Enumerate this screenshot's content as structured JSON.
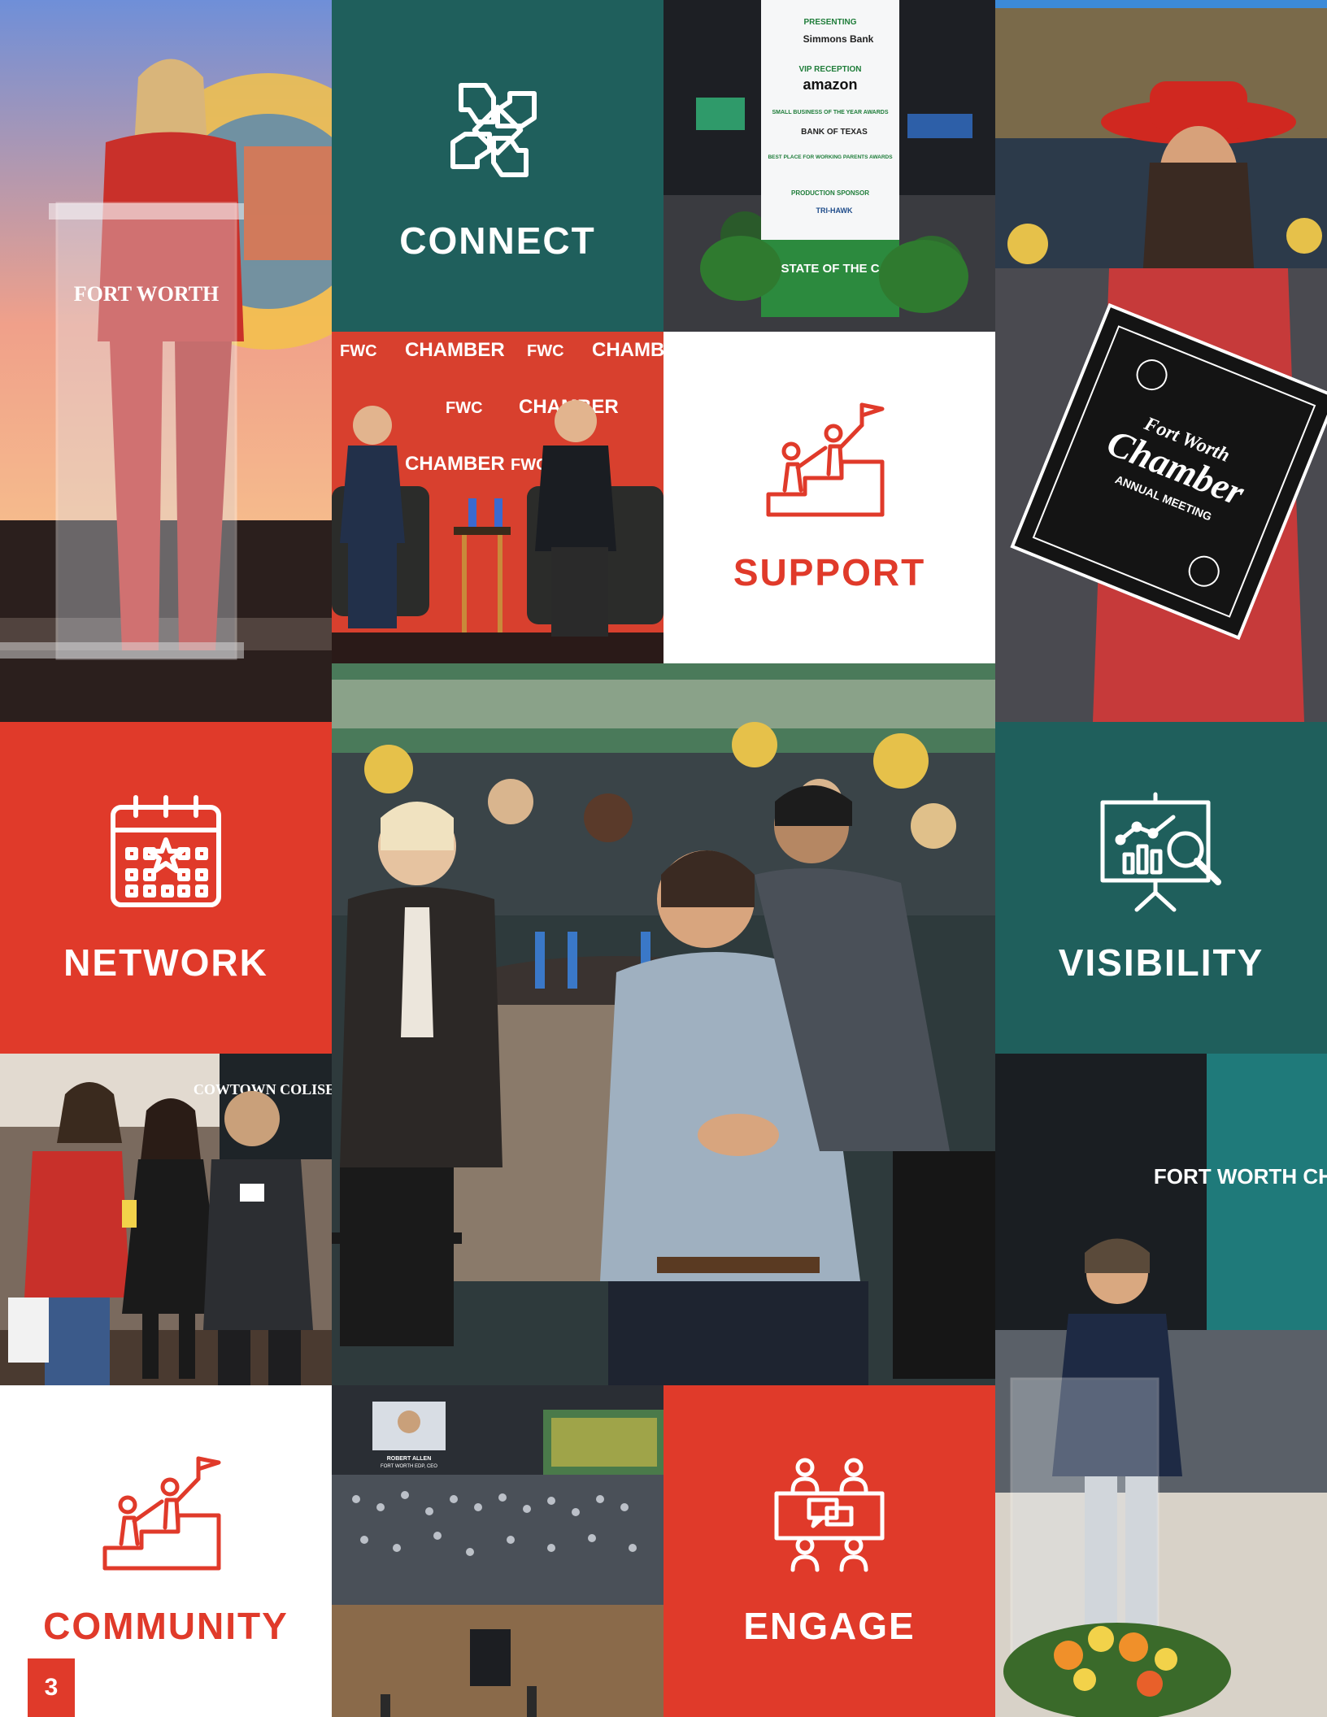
{
  "tiles": {
    "connect": "CONNECT",
    "support": "SUPPORT",
    "network": "NETWORK",
    "visibility": "VISIBILITY",
    "community": "COMMUNITY",
    "engage": "ENGAGE"
  },
  "page_number": "3",
  "colors": {
    "teal": "#1f5f5c",
    "red": "#e03a2a",
    "white": "#ffffff"
  },
  "photo_text": {
    "podium_brand": "FORT WORTH",
    "backdrop_fwc": "FWC",
    "backdrop_chamber": "CHAMBER",
    "sign_presenting": "PRESENTING",
    "sign_simmons": "Simmons Bank",
    "sign_vip": "VIP RECEPTION",
    "sign_amazon": "amazon",
    "sign_small_business": "SMALL BUSINESS OF THE YEAR AWARDS",
    "sign_bank_texas": "BANK OF TEXAS",
    "sign_working_parents": "BEST PLACE FOR WORKING PARENTS AWARDS",
    "sign_production": "PRODUCTION SPONSOR",
    "sign_trihawk": "TRI-HAWK",
    "sign_state": "STATE OF THE C",
    "bandana_title": "Chamber",
    "bandana_top": "Fort Worth",
    "bandana_sub": "ANNUAL MEETING",
    "cowtown_sign": "COWTOWN COLISEUM",
    "screen_brand": "FORT WORTH CHAMB",
    "arena_caption_name": "ROBERT ALLEN",
    "arena_caption_title": "FORT WORTH EDP, CEO"
  }
}
